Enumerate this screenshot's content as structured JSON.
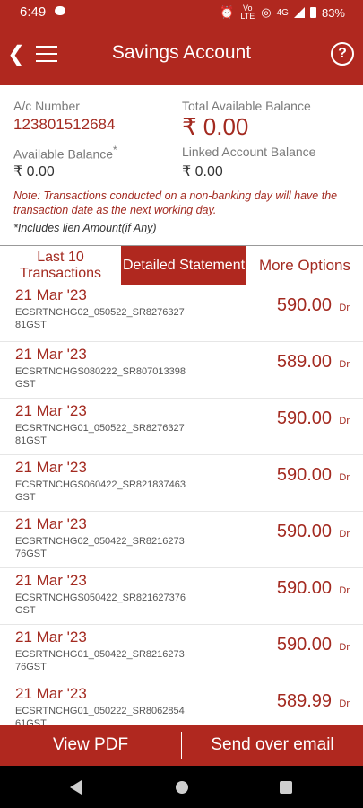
{
  "status_bar": {
    "time": "6:49",
    "network": "4G",
    "volte": "Vo LTE",
    "battery": "83%"
  },
  "app_bar": {
    "title": "Savings Account",
    "help": "?"
  },
  "summary": {
    "ac_number_label": "A/c Number",
    "ac_number": "123801512684",
    "total_balance_label": "Total Available Balance",
    "total_balance": "₹ 0.00",
    "available_balance_label": "Available Balance",
    "available_balance_mark": "*",
    "available_balance": "₹ 0.00",
    "linked_balance_label": "Linked Account Balance",
    "linked_balance": "₹ 0.00",
    "note": "Note: Transactions conducted on a non-banking day will have the transaction date as the next working day.",
    "lien_note": "*Includes lien Amount(if Any)"
  },
  "tabs": [
    {
      "label": "Last 10 Transactions"
    },
    {
      "label": "Detailed Statement"
    },
    {
      "label": "More Options"
    }
  ],
  "transactions": [
    {
      "date": "21 Mar '23",
      "desc": "ECSRTNCHG02_050522_SR827632781GST",
      "amount": "590.00",
      "type": "Dr"
    },
    {
      "date": "21 Mar '23",
      "desc": "ECSRTNCHGS080222_SR807013398GST",
      "amount": "589.00",
      "type": "Dr"
    },
    {
      "date": "21 Mar '23",
      "desc": "ECSRTNCHG01_050522_SR827632781GST",
      "amount": "590.00",
      "type": "Dr"
    },
    {
      "date": "21 Mar '23",
      "desc": "ECSRTNCHGS060422_SR821837463GST",
      "amount": "590.00",
      "type": "Dr"
    },
    {
      "date": "21 Mar '23",
      "desc": "ECSRTNCHG02_050422_SR821627376GST",
      "amount": "590.00",
      "type": "Dr"
    },
    {
      "date": "21 Mar '23",
      "desc": "ECSRTNCHGS050422_SR821627376GST",
      "amount": "590.00",
      "type": "Dr"
    },
    {
      "date": "21 Mar '23",
      "desc": "ECSRTNCHG01_050422_SR821627376GST",
      "amount": "590.00",
      "type": "Dr"
    },
    {
      "date": "21 Mar '23",
      "desc": "ECSRTNCHG01_050222_SR806285461GST",
      "amount": "589.99",
      "type": "Dr"
    }
  ],
  "actions": {
    "view_pdf": "View PDF",
    "send_email": "Send over email"
  },
  "colors": {
    "brand": "#b0281f",
    "accent_text": "#a32a20"
  }
}
